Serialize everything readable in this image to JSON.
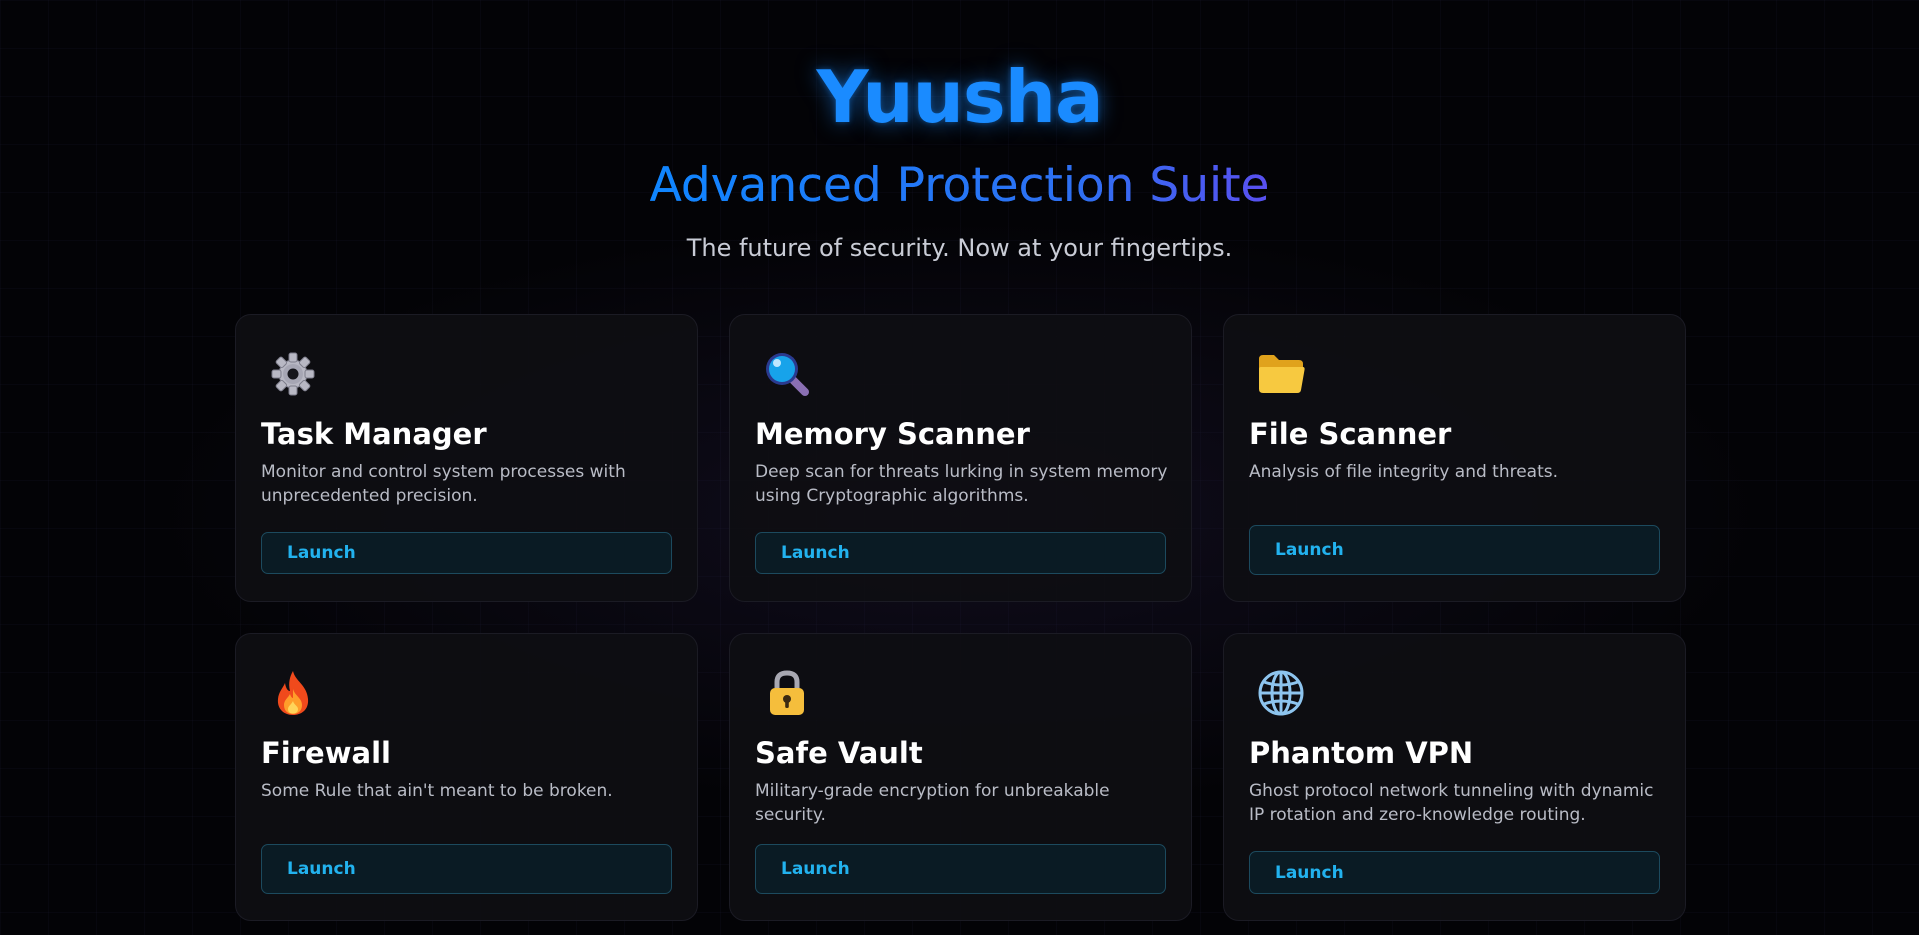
{
  "hero": {
    "brand": "Yuusha",
    "subtitle": "Advanced Protection Suite",
    "tagline": "The future of security. Now at your fingertips."
  },
  "colors": {
    "brand": "#1a8bff",
    "accent_cyan": "#22b2ee",
    "card_bg": "#0e0e12",
    "page_bg": "#030306"
  },
  "cards": [
    {
      "icon": "gear-icon",
      "title": "Task Manager",
      "description": "Monitor and control system processes with unprecedented precision.",
      "button": "Launch"
    },
    {
      "icon": "magnifier-icon",
      "title": "Memory Scanner",
      "description": "Deep scan for threats lurking in system memory using Cryptographic algorithms.",
      "button": "Launch"
    },
    {
      "icon": "folder-icon",
      "title": "File Scanner",
      "description": "Analysis of file integrity and threats.",
      "button": "Launch"
    },
    {
      "icon": "fire-icon",
      "title": "Firewall",
      "description": "Some Rule that ain't meant to be broken.",
      "button": "Launch"
    },
    {
      "icon": "lock-icon",
      "title": "Safe Vault",
      "description": "Military-grade encryption for unbreakable security.",
      "button": "Launch"
    },
    {
      "icon": "globe-icon",
      "title": "Phantom VPN",
      "description": "Ghost protocol network tunneling with dynamic IP rotation and zero-knowledge routing.",
      "button": "Launch"
    }
  ]
}
